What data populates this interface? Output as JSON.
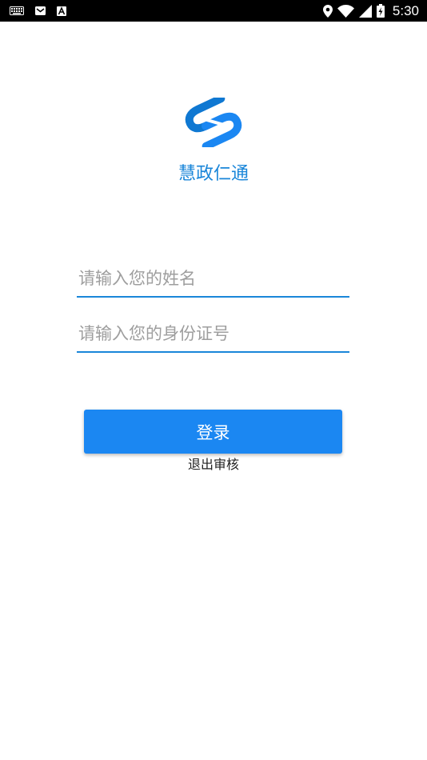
{
  "status_bar": {
    "time": "5:30",
    "left_icons": [
      "keyboard-icon",
      "gmail-icon",
      "font-a-icon"
    ],
    "right_icons": [
      "location-icon",
      "wifi-icon",
      "signal-icon",
      "battery-charging-icon"
    ]
  },
  "app": {
    "name": "慧政仁通",
    "logo": "app-logo-s-icon",
    "brand_color": "#1a86d9"
  },
  "form": {
    "name_placeholder": "请输入您的姓名",
    "name_value": "",
    "id_placeholder": "请输入您的身份证号",
    "id_value": ""
  },
  "actions": {
    "login_label": "登录",
    "login_color": "#1b87f2",
    "exit_label": "退出审核"
  }
}
